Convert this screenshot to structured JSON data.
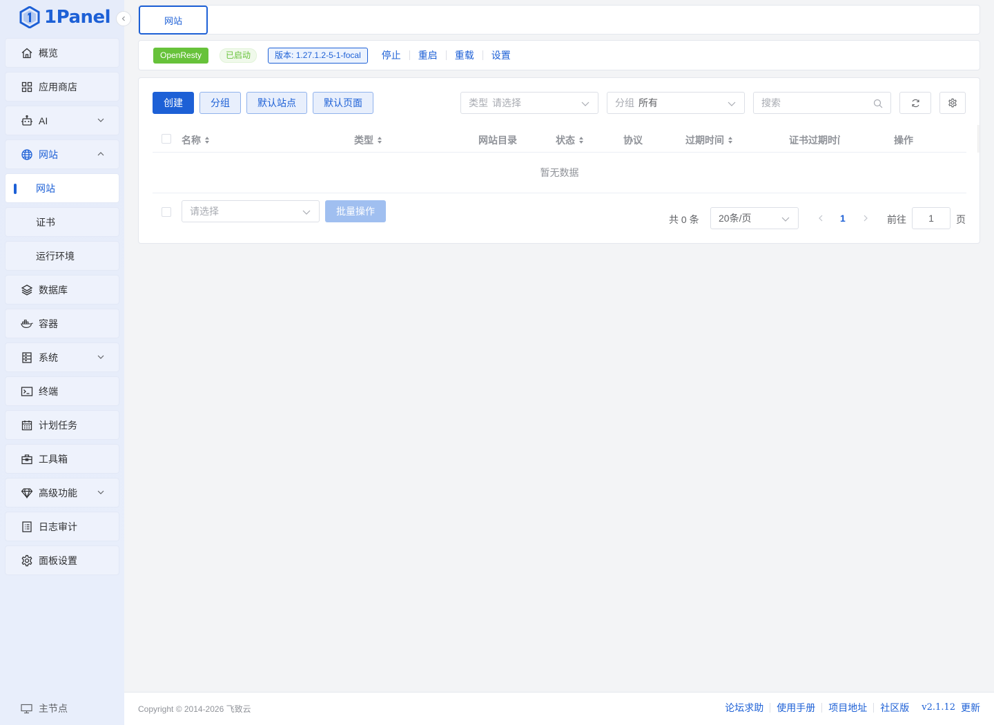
{
  "app": {
    "logo_text": "1Panel"
  },
  "sidebar": {
    "items": [
      {
        "label": "概览",
        "icon": "home-icon"
      },
      {
        "label": "应用商店",
        "icon": "apps-icon"
      },
      {
        "label": "AI",
        "icon": "robot-icon"
      },
      {
        "label": "网站",
        "icon": "globe-icon"
      },
      {
        "label": "网站"
      },
      {
        "label": "证书"
      },
      {
        "label": "运行环境"
      },
      {
        "label": "数据库",
        "icon": "layers-icon"
      },
      {
        "label": "容器",
        "icon": "docker-icon"
      },
      {
        "label": "系统",
        "icon": "server-icon"
      },
      {
        "label": "终端",
        "icon": "terminal-icon"
      },
      {
        "label": "计划任务",
        "icon": "calendar-icon"
      },
      {
        "label": "工具箱",
        "icon": "toolbox-icon"
      },
      {
        "label": "高级功能",
        "icon": "diamond-icon"
      },
      {
        "label": "日志审计",
        "icon": "log-icon"
      },
      {
        "label": "面板设置",
        "icon": "gear-icon"
      }
    ],
    "node_label": "主节点"
  },
  "tabs": {
    "active": "网站"
  },
  "status": {
    "app_name": "OpenResty",
    "state": "已启动",
    "version": "版本: 1.27.1.2-5-1-focal",
    "actions": [
      "停止",
      "重启",
      "重载",
      "设置"
    ]
  },
  "toolbar": {
    "create": "创建",
    "group": "分组",
    "default_site": "默认站点",
    "default_page": "默认页面",
    "type_filter": {
      "label": "类型",
      "placeholder": "请选择"
    },
    "group_filter": {
      "label": "分组",
      "value": "所有"
    },
    "search_placeholder": "搜索"
  },
  "table": {
    "columns": [
      "名称",
      "类型",
      "网站目录",
      "状态",
      "协议",
      "过期时间",
      "证书过期时间",
      "操作"
    ],
    "empty_text": "暂无数据"
  },
  "batch": {
    "placeholder": "请选择",
    "button": "批量操作"
  },
  "pagination": {
    "total": "共 0 条",
    "page_size": "20条/页",
    "current_page": "1",
    "goto_label": "前往",
    "goto_value": "1",
    "page_suffix": "页"
  },
  "footer": {
    "copyright": "Copyright © 2014-2026 飞致云",
    "links": [
      "论坛求助",
      "使用手册",
      "项目地址",
      "社区版"
    ],
    "version": "v2.1.12",
    "update": "更新"
  },
  "colors": {
    "primary": "#1d60d6",
    "success": "#67c23a",
    "sidebar_bg": "#e6ecfa"
  }
}
